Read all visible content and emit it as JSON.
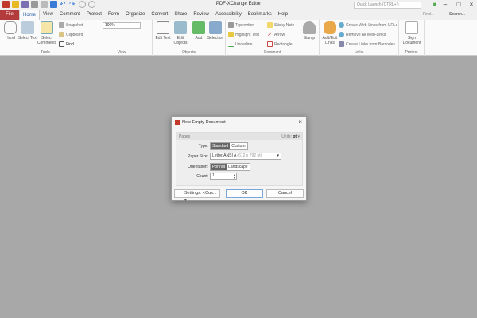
{
  "window": {
    "title": "PDF-XChange Editor",
    "quick_launch_placeholder": "Quick Launch (CTRL+.)"
  },
  "tabs": [
    "File",
    "Home",
    "View",
    "Comment",
    "Protect",
    "Form",
    "Organize",
    "Convert",
    "Share",
    "Review",
    "Accessibility",
    "Bookmarks",
    "Help"
  ],
  "tab_right": {
    "find": "Find...",
    "search": "Search..."
  },
  "ribbon": {
    "tools": {
      "label": "Tools",
      "hand": "Hand",
      "select_text": "Select Text",
      "select_comments": "Select Comments",
      "snapshot": "Snapshot",
      "clipboard": "Clipboard",
      "find": "Find"
    },
    "view": {
      "label": "View",
      "zoom": "100%"
    },
    "objects": {
      "label": "Objects",
      "edit_text": "Edit Text",
      "edit_objects": "Edit Objects",
      "add": "Add",
      "selection": "Selection"
    },
    "comment": {
      "label": "Comment",
      "typewriter": "Typewriter",
      "highlight": "Highlight Text",
      "underline": "Underline",
      "sticky": "Sticky Note",
      "arrow": "Arrow",
      "rectangle": "Rectangle",
      "stamp": "Stamp"
    },
    "links": {
      "label": "Links",
      "add_edit": "Add/Edit Links",
      "create_urls": "Create Web-Links from URLs",
      "remove_all": "Remove All Web-Links",
      "barcodes": "Create Links from Barcodes"
    },
    "protect": {
      "label": "Protect",
      "sign": "Sign Document"
    }
  },
  "dialog": {
    "title": "New Empty Document",
    "section": "Pages",
    "units_label": "Units:",
    "units": "pt",
    "type_label": "Type:",
    "type_options": [
      "Standard",
      "Custom"
    ],
    "paper_label": "Paper Size:",
    "paper_value": "Letter/ANSI A",
    "paper_dims": "(612 x 792 pt)",
    "orientation_label": "Orientation:",
    "orientation_options": [
      "Portrait",
      "Landscape"
    ],
    "count_label": "Count:",
    "count": "1",
    "settings": "Settings: <Cus...",
    "ok": "OK",
    "cancel": "Cancel"
  }
}
